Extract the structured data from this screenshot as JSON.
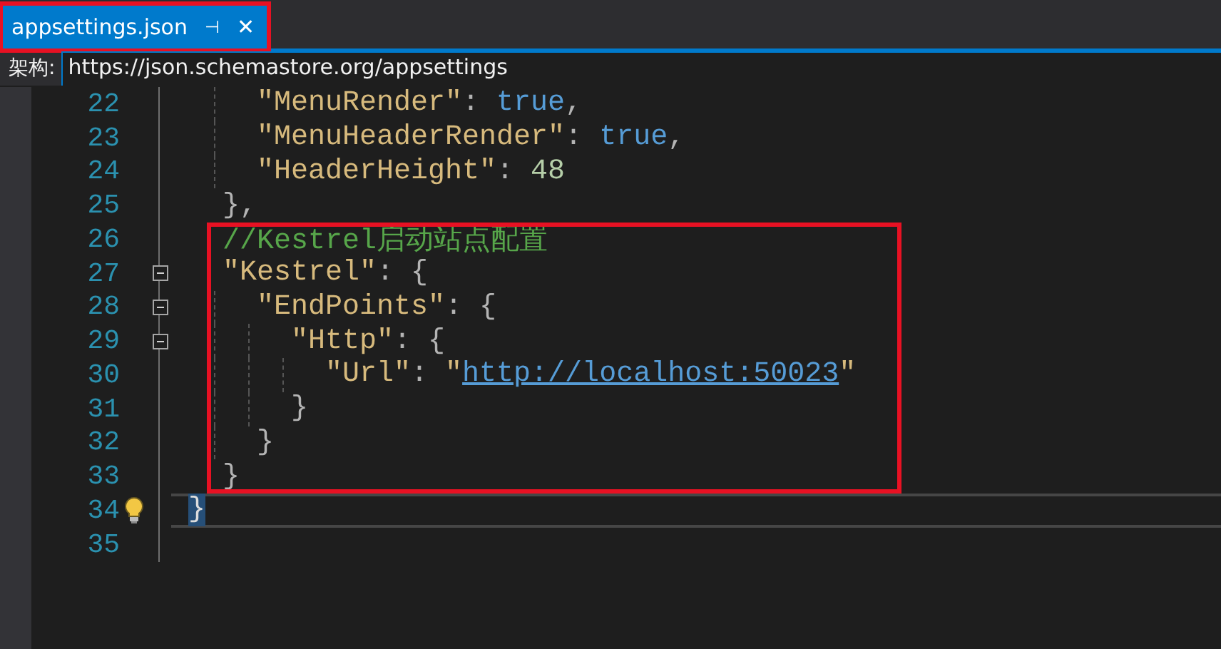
{
  "tab": {
    "title": "appsettings.json",
    "pin_icon": "⊣",
    "close_icon": "✕",
    "selected": true,
    "boxed": true
  },
  "schema": {
    "label": "架构:",
    "value": "https://json.schemastore.org/appsettings"
  },
  "lines": [
    {
      "number": "22",
      "kind": "four",
      "fold": false,
      "boxed": false,
      "current": false,
      "bulb": false,
      "tokens": [
        {
          "kind": "key",
          "text": "\"MenuRender\""
        },
        {
          "kind": "punct",
          "text": ": "
        },
        {
          "kind": "bool",
          "text": "true"
        },
        {
          "kind": "punct",
          "text": ","
        }
      ]
    },
    {
      "number": "23",
      "kind": "four",
      "fold": false,
      "boxed": false,
      "current": false,
      "bulb": false,
      "tokens": [
        {
          "kind": "key",
          "text": "\"MenuHeaderRender\""
        },
        {
          "kind": "punct",
          "text": ": "
        },
        {
          "kind": "bool",
          "text": "true"
        },
        {
          "kind": "punct",
          "text": ","
        }
      ]
    },
    {
      "number": "24",
      "kind": "four",
      "fold": false,
      "boxed": false,
      "current": false,
      "bulb": false,
      "tokens": [
        {
          "kind": "key",
          "text": "\"HeaderHeight\""
        },
        {
          "kind": "punct",
          "text": ": "
        },
        {
          "kind": "number",
          "text": "48"
        }
      ]
    },
    {
      "number": "25",
      "kind": "two",
      "fold": false,
      "boxed": false,
      "current": false,
      "bulb": false,
      "tokens": [
        {
          "kind": "punct",
          "text": "},"
        }
      ]
    },
    {
      "number": "26",
      "kind": "two",
      "fold": false,
      "boxed": true,
      "current": false,
      "bulb": false,
      "tokens": [
        {
          "kind": "comment",
          "text": "//Kestrel启动站点配置"
        }
      ]
    },
    {
      "number": "27",
      "kind": "two",
      "fold": true,
      "boxed": true,
      "current": false,
      "bulb": false,
      "tokens": [
        {
          "kind": "key",
          "text": "\"Kestrel\""
        },
        {
          "kind": "punct",
          "text": ": {"
        }
      ]
    },
    {
      "number": "28",
      "kind": "four",
      "fold": true,
      "boxed": true,
      "current": false,
      "bulb": false,
      "tokens": [
        {
          "kind": "key",
          "text": "\"EndPoints\""
        },
        {
          "kind": "punct",
          "text": ": {"
        }
      ]
    },
    {
      "number": "29",
      "kind": "six",
      "fold": true,
      "boxed": true,
      "current": false,
      "bulb": false,
      "tokens": [
        {
          "kind": "key",
          "text": "\"Http\""
        },
        {
          "kind": "punct",
          "text": ": {"
        }
      ]
    },
    {
      "number": "30",
      "kind": "eight",
      "fold": false,
      "boxed": true,
      "current": false,
      "bulb": false,
      "tokens": [
        {
          "kind": "key",
          "text": "\"Url\""
        },
        {
          "kind": "punct",
          "text": ": "
        },
        {
          "kind": "key",
          "text": "\""
        },
        {
          "kind": "link",
          "text": "http://localhost:50023"
        },
        {
          "kind": "key",
          "text": "\""
        }
      ]
    },
    {
      "number": "31",
      "kind": "six",
      "fold": false,
      "boxed": true,
      "current": false,
      "bulb": false,
      "tokens": [
        {
          "kind": "punct",
          "text": "}"
        }
      ]
    },
    {
      "number": "32",
      "kind": "four",
      "fold": false,
      "boxed": true,
      "current": false,
      "bulb": false,
      "tokens": [
        {
          "kind": "punct",
          "text": "}"
        }
      ]
    },
    {
      "number": "33",
      "kind": "two",
      "fold": false,
      "boxed": true,
      "current": false,
      "bulb": false,
      "tokens": [
        {
          "kind": "punct",
          "text": "}"
        }
      ]
    },
    {
      "number": "34",
      "kind": "none",
      "fold": false,
      "boxed": false,
      "current": true,
      "bulb": true,
      "tokens": [
        {
          "kind": "match",
          "text": "}"
        }
      ]
    },
    {
      "number": "35",
      "kind": "none",
      "fold": false,
      "boxed": false,
      "current": false,
      "bulb": false
    }
  ]
}
